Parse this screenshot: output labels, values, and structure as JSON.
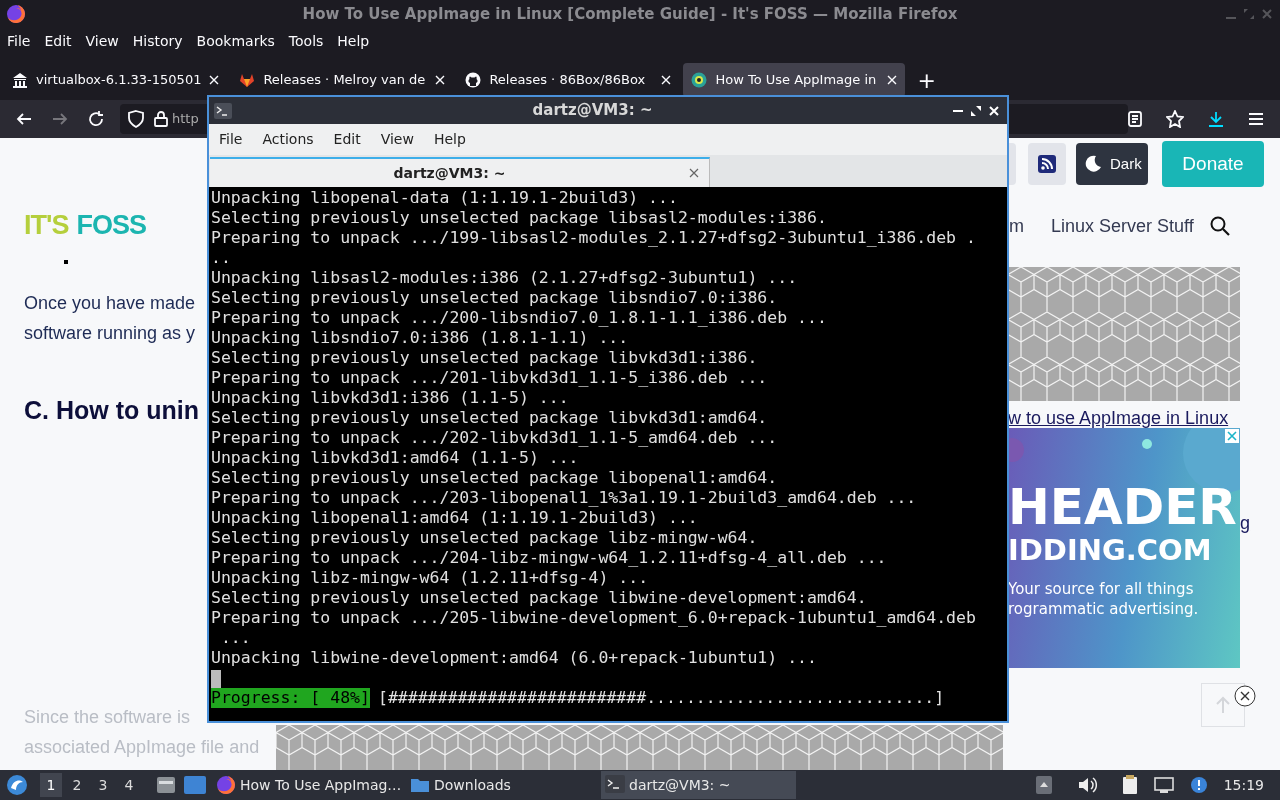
{
  "firefox": {
    "title": "How To Use AppImage in Linux [Complete Guide] - It's FOSS — Mozilla Firefox",
    "menu": [
      "File",
      "Edit",
      "View",
      "History",
      "Bookmarks",
      "Tools",
      "Help"
    ],
    "tabs": [
      {
        "label": "virtualbox-6.1.33-150501",
        "selected": false
      },
      {
        "label": "Releases · Melroy van de",
        "selected": false
      },
      {
        "label": "Releases · 86Box/86Box",
        "selected": false
      },
      {
        "label": "How To Use AppImage in",
        "selected": true
      }
    ],
    "new_tab": "+",
    "url": "http"
  },
  "page": {
    "logo": [
      "IT'S",
      "FOSS"
    ],
    "paragraph": [
      "Once you have made",
      "software running as y"
    ],
    "heading": "C. How to unin",
    "faded_text": [
      "Since the software is",
      "associated AppImage file and"
    ],
    "header_buttons": {
      "dark": "Dark",
      "donate": "Donate"
    },
    "nav": [
      "m",
      "Linux Server Stuff"
    ],
    "link": "w to use AppImage in Linux",
    "link_fragment": "g",
    "ad": [
      "HEADER",
      "IDDING.COM",
      "Your source for all things",
      "rogrammatic advertising."
    ]
  },
  "terminal": {
    "title": "dartz@VM3: ~",
    "menu": [
      "File",
      "Actions",
      "Edit",
      "View",
      "Help"
    ],
    "tab": "dartz@VM3: ~",
    "lines": [
      "Unpacking libopenal-data (1:1.19.1-2build3) ...",
      "Selecting previously unselected package libsasl2-modules:i386.",
      "Preparing to unpack .../199-libsasl2-modules_2.1.27+dfsg2-3ubuntu1_i386.deb .",
      "..",
      "Unpacking libsasl2-modules:i386 (2.1.27+dfsg2-3ubuntu1) ...",
      "Selecting previously unselected package libsndio7.0:i386.",
      "Preparing to unpack .../200-libsndio7.0_1.8.1-1.1_i386.deb ...",
      "Unpacking libsndio7.0:i386 (1.8.1-1.1) ...",
      "Selecting previously unselected package libvkd3d1:i386.",
      "Preparing to unpack .../201-libvkd3d1_1.1-5_i386.deb ...",
      "Unpacking libvkd3d1:i386 (1.1-5) ...",
      "Selecting previously unselected package libvkd3d1:amd64.",
      "Preparing to unpack .../202-libvkd3d1_1.1-5_amd64.deb ...",
      "Unpacking libvkd3d1:amd64 (1.1-5) ...",
      "Selecting previously unselected package libopenal1:amd64.",
      "Preparing to unpack .../203-libopenal1_1%3a1.19.1-2build3_amd64.deb ...",
      "Unpacking libopenal1:amd64 (1:1.19.1-2build3) ...",
      "Selecting previously unselected package libz-mingw-w64.",
      "Preparing to unpack .../204-libz-mingw-w64_1.2.11+dfsg-4_all.deb ...",
      "Unpacking libz-mingw-w64 (1.2.11+dfsg-4) ...",
      "Selecting previously unselected package libwine-development:amd64.",
      "Preparing to unpack .../205-libwine-development_6.0+repack-1ubuntu1_amd64.deb",
      " ...",
      "Unpacking libwine-development:amd64 (6.0+repack-1ubuntu1) ..."
    ],
    "progress": {
      "label": "Progress: [ 48%]",
      "bar": "[##########################.............................]"
    }
  },
  "taskbar": {
    "workspaces": [
      {
        "label": "1",
        "selected": true
      },
      {
        "label": "2",
        "selected": false
      },
      {
        "label": "3",
        "selected": false
      },
      {
        "label": "4",
        "selected": false
      }
    ],
    "tasks": [
      {
        "label": "How To Use AppImag…",
        "selected": false
      },
      {
        "label": "Downloads",
        "selected": false
      },
      {
        "label": "dartz@VM3: ~",
        "selected": true
      }
    ],
    "clock": "15:19"
  }
}
